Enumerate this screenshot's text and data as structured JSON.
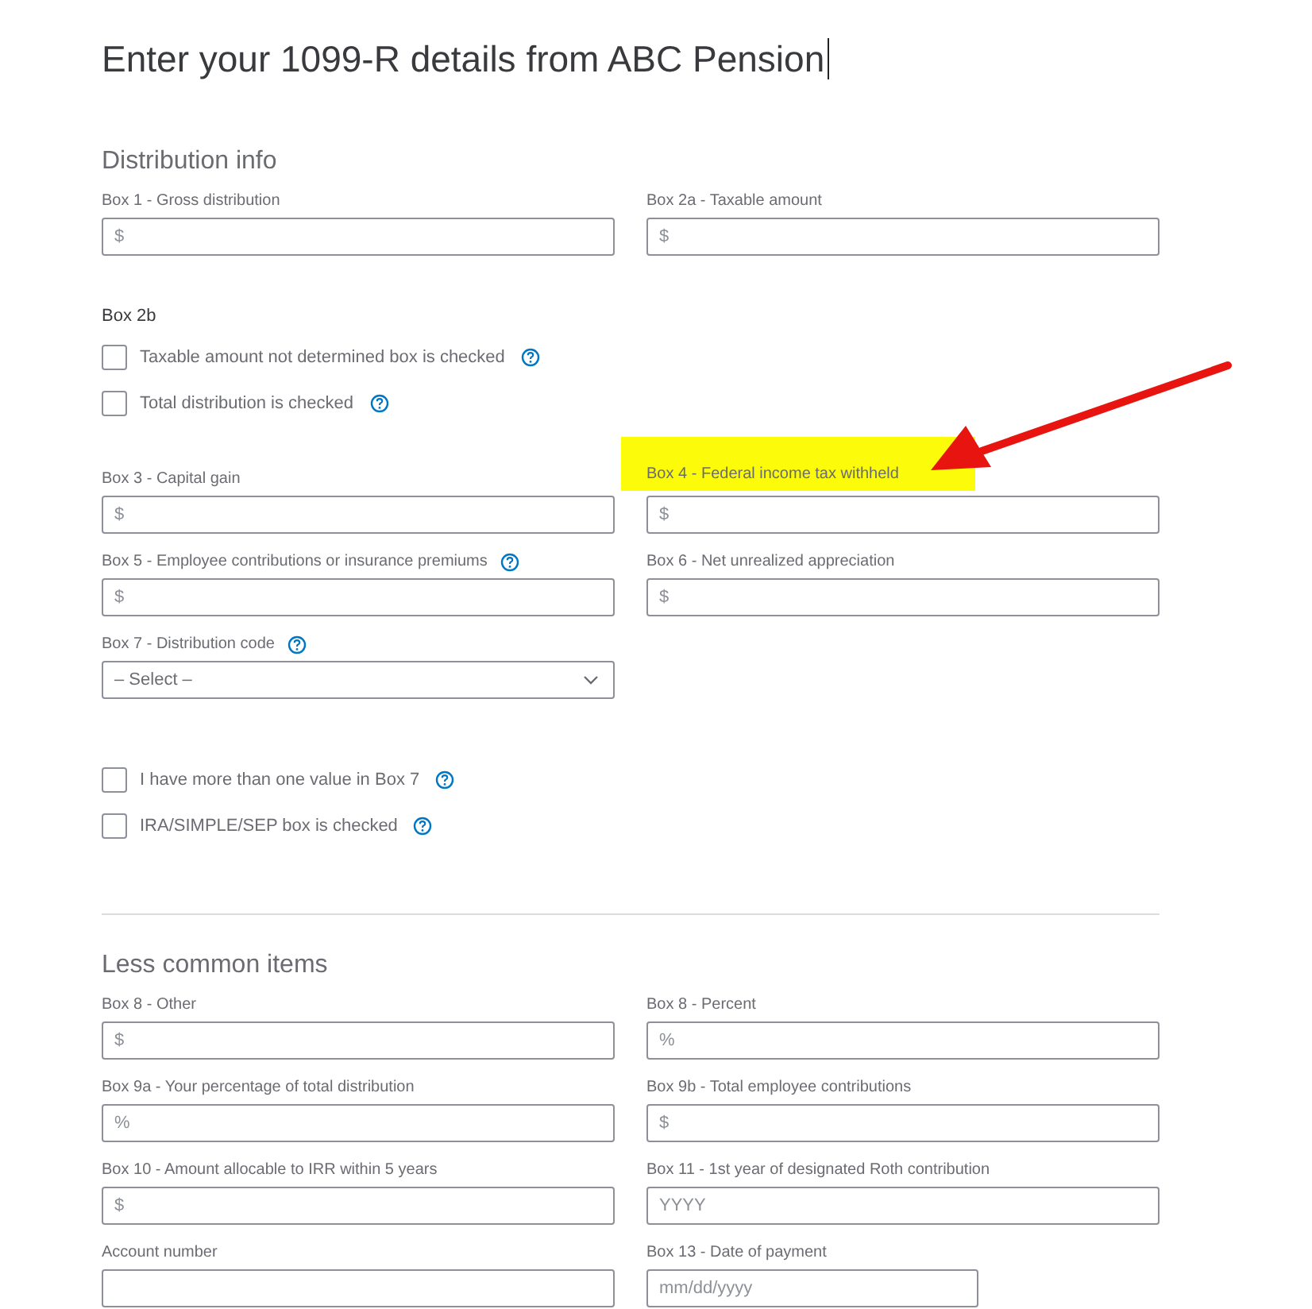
{
  "title": "Enter your 1099-R details from ABC Pension",
  "sections": [
    {
      "heading": "Distribution info",
      "blocks": [
        {
          "kind": "fields",
          "fields": [
            {
              "kind": "input",
              "label": "Box 1 - Gross distribution",
              "placeholder": "$",
              "help": false,
              "highlighted": false
            },
            {
              "kind": "input",
              "label": "Box 2a - Taxable amount",
              "placeholder": "$",
              "help": false,
              "highlighted": false
            }
          ]
        },
        {
          "kind": "label",
          "text": "Box 2b"
        },
        {
          "kind": "checkbox",
          "label": "Taxable amount not determined box is checked",
          "checked": false,
          "help": true
        },
        {
          "kind": "checkbox",
          "label": "Total distribution is checked",
          "checked": false,
          "help": true
        },
        {
          "kind": "fields",
          "fields": [
            {
              "kind": "input",
              "label": "Box 3 - Capital gain",
              "placeholder": "$",
              "help": false,
              "highlighted": false
            },
            {
              "kind": "input",
              "label": "Box 4 - Federal income tax withheld",
              "placeholder": "$",
              "help": false,
              "highlighted": true
            }
          ]
        },
        {
          "kind": "fields",
          "fields": [
            {
              "kind": "input",
              "label": "Box 5 - Employee contributions or insurance premiums",
              "placeholder": "$",
              "help": true,
              "highlighted": false
            },
            {
              "kind": "input",
              "label": "Box 6 - Net unrealized appreciation",
              "placeholder": "$",
              "help": false,
              "highlighted": false
            }
          ]
        },
        {
          "kind": "fields",
          "fields": [
            {
              "kind": "select",
              "label": "Box 7 - Distribution code",
              "value": "– Select –",
              "help": true,
              "highlighted": false
            }
          ]
        },
        {
          "kind": "checkbox",
          "label": "I have more than one value in Box 7",
          "checked": false,
          "help": true
        },
        {
          "kind": "checkbox",
          "label": "IRA/SIMPLE/SEP box is checked",
          "checked": false,
          "help": true
        }
      ]
    },
    {
      "heading": "Less common items",
      "blocks": [
        {
          "kind": "fields",
          "fields": [
            {
              "kind": "input",
              "label": "Box 8 - Other",
              "placeholder": "$",
              "help": false,
              "highlighted": false
            },
            {
              "kind": "input",
              "label": "Box 8 - Percent",
              "placeholder": "%",
              "help": false,
              "highlighted": false
            }
          ]
        },
        {
          "kind": "fields",
          "fields": [
            {
              "kind": "input",
              "label": "Box 9a - Your percentage of total distribution",
              "placeholder": "%",
              "help": false,
              "highlighted": false
            },
            {
              "kind": "input",
              "label": "Box 9b - Total employee contributions",
              "placeholder": "$",
              "help": false,
              "highlighted": false
            }
          ]
        },
        {
          "kind": "fields",
          "fields": [
            {
              "kind": "input",
              "label": "Box 10 - Amount allocable to IRR within 5 years",
              "placeholder": "$",
              "help": false,
              "highlighted": false
            },
            {
              "kind": "input",
              "label": "Box 11 - 1st year of designated Roth contribution",
              "placeholder": "YYYY",
              "help": false,
              "highlighted": false
            }
          ]
        },
        {
          "kind": "fields",
          "fields": [
            {
              "kind": "input",
              "label": "Account number",
              "help": false,
              "highlighted": false
            },
            {
              "kind": "date",
              "label": "Box 13 - Date of payment",
              "placeholder": "mm/dd/yyyy",
              "help": false,
              "highlighted": false
            }
          ]
        }
      ]
    }
  ]
}
